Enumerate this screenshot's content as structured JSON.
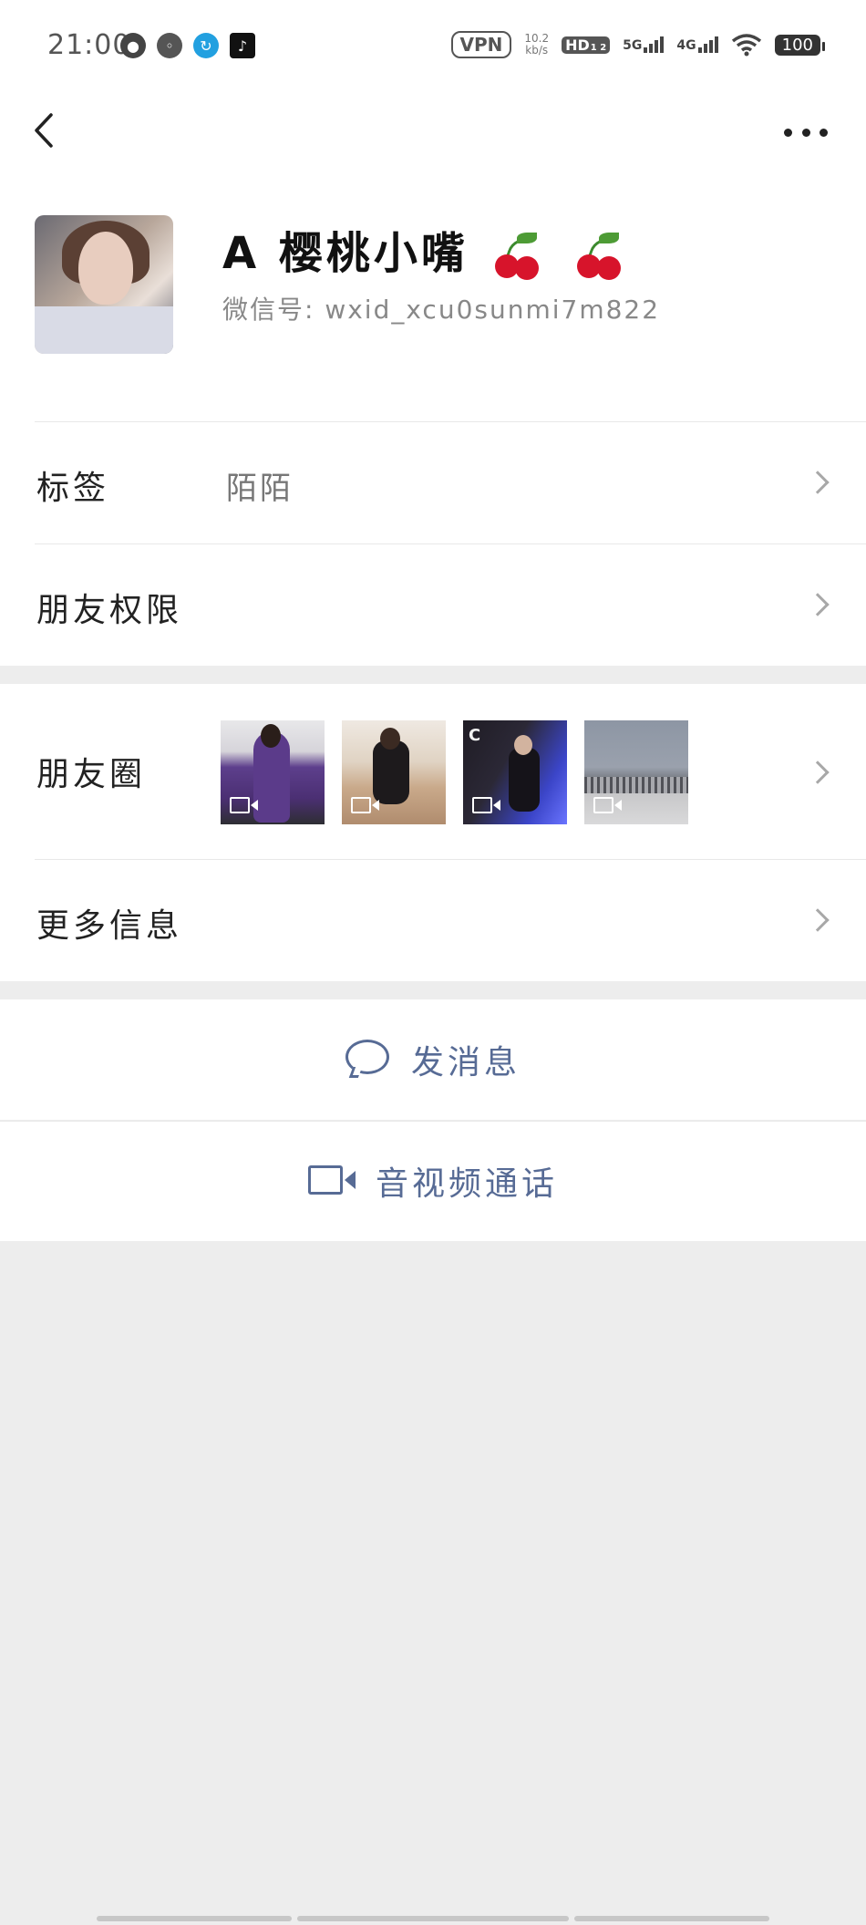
{
  "status_bar": {
    "time": "21:00",
    "vpn": "VPN",
    "net_speed_top": "10.2",
    "net_speed_unit": "kb/s",
    "hd": "HD",
    "hd_sub": "1 2",
    "signal_1": "5G",
    "signal_2": "4G",
    "battery": "100"
  },
  "nav": {
    "back_icon": "chevron-left-icon",
    "more_icon": "more-dots-icon"
  },
  "profile": {
    "nickname": "A 樱桃小嘴",
    "emoji": "cherry",
    "wechat_id": "微信号: wxid_xcu0sunmi7m822"
  },
  "rows": {
    "tags_label": "标签",
    "tags_value": "陌陌",
    "permissions_label": "朋友权限",
    "moments_label": "朋友圈",
    "more_info_label": "更多信息"
  },
  "moments_thumbs": [
    {
      "kind": "video",
      "desc": "purple-outfit"
    },
    {
      "kind": "video",
      "desc": "sofa"
    },
    {
      "kind": "video",
      "desc": "blue-light"
    },
    {
      "kind": "video",
      "desc": "street"
    }
  ],
  "actions": {
    "message_label": "发消息",
    "call_label": "音视频通话"
  },
  "colors": {
    "accent_link": "#576b95",
    "background": "#ededed",
    "card": "#ffffff"
  }
}
